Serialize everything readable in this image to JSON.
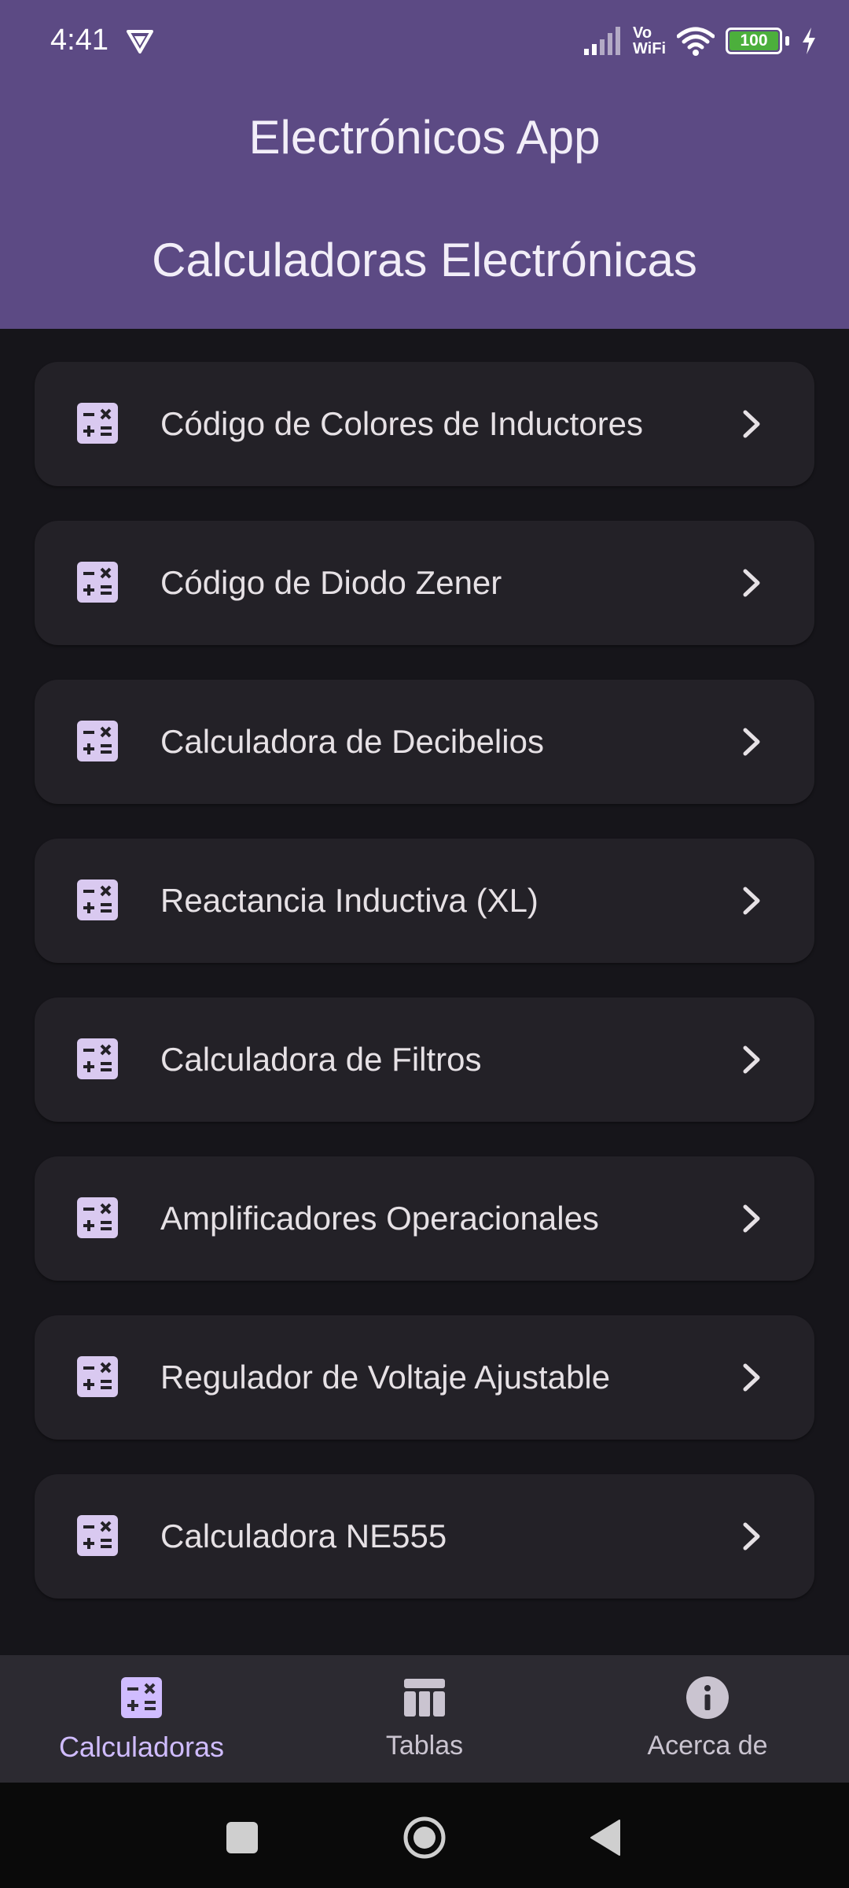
{
  "status_bar": {
    "time": "4:41",
    "network_label_top": "Vo",
    "network_label_bottom": "WiFi",
    "battery": "100",
    "icons": [
      "vpn-icon",
      "signal-icon",
      "wifi-icon",
      "battery-icon",
      "charging-icon"
    ]
  },
  "header": {
    "app_title": "Electrónicos App",
    "section_title": "Calculadoras Electrónicas"
  },
  "calculators": [
    {
      "label": "Código de Colores de Inductores",
      "icon": "calculator-icon"
    },
    {
      "label": "Código de Diodo Zener",
      "icon": "calculator-icon"
    },
    {
      "label": "Calculadora de Decibelios",
      "icon": "calculator-icon"
    },
    {
      "label": "Reactancia Inductiva (XL)",
      "icon": "calculator-icon"
    },
    {
      "label": "Calculadora de Filtros",
      "icon": "calculator-icon"
    },
    {
      "label": "Amplificadores Operacionales",
      "icon": "calculator-icon"
    },
    {
      "label": "Regulador de Voltaje Ajustable",
      "icon": "calculator-icon"
    },
    {
      "label": "Calculadora NE555",
      "icon": "calculator-icon"
    }
  ],
  "bottom_nav": {
    "items": [
      {
        "label": "Calculadoras",
        "icon": "calculator-icon",
        "active": true
      },
      {
        "label": "Tablas",
        "icon": "table-icon",
        "active": false
      },
      {
        "label": "Acerca de",
        "icon": "info-icon",
        "active": false
      }
    ]
  },
  "system_nav": [
    "recents-button",
    "home-button",
    "back-button"
  ],
  "colors": {
    "header_bg": "#5c4a84",
    "background": "#16151a",
    "card_bg": "#232127",
    "icon_tint": "#d9c9f0",
    "active_nav": "#d0bcff",
    "nav_bg": "#2c2a31",
    "battery_fill": "#4caf3c"
  }
}
